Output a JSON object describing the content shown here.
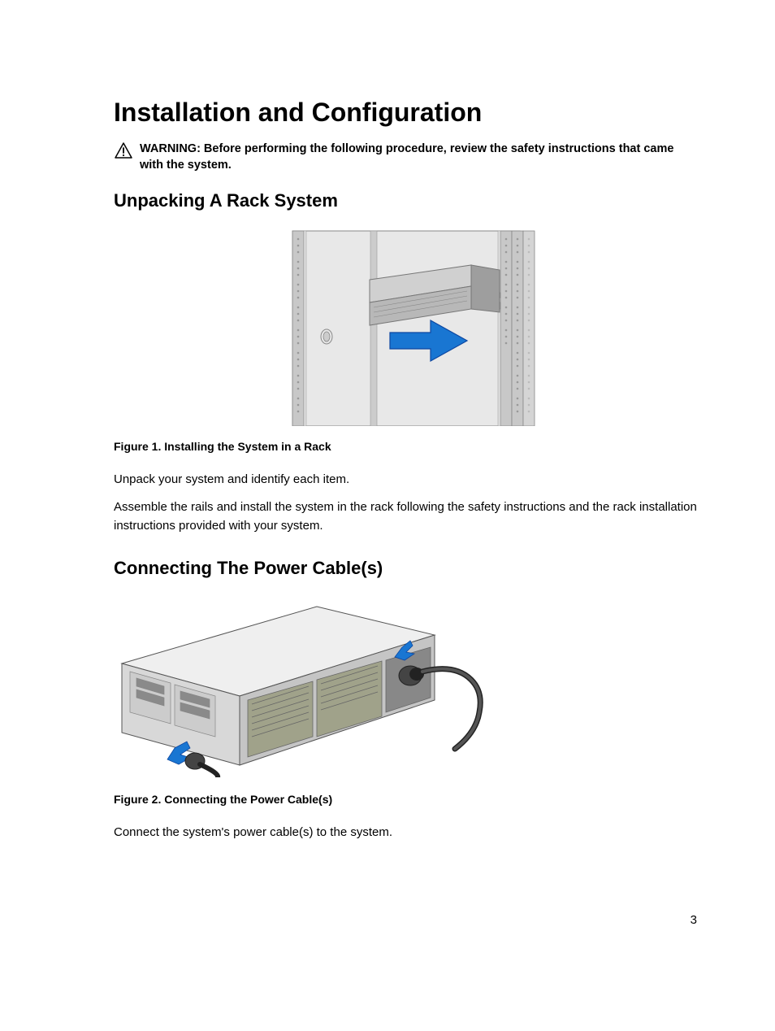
{
  "title": "Installation and Configuration",
  "warning": {
    "text": "WARNING: Before performing the following procedure, review the safety instructions that came with the system."
  },
  "section1": {
    "heading": "Unpacking A Rack System",
    "figure_caption": "Figure 1. Installing the System in a Rack",
    "para1": "Unpack your system and identify each item.",
    "para2": "Assemble the rails and install the system in the rack following the safety instructions and the rack installation instructions provided with your system."
  },
  "section2": {
    "heading": "Connecting The Power Cable(s)",
    "figure_caption": "Figure 2. Connecting the Power Cable(s)",
    "para1": "Connect the system's power cable(s) to the system."
  },
  "page_number": "3"
}
